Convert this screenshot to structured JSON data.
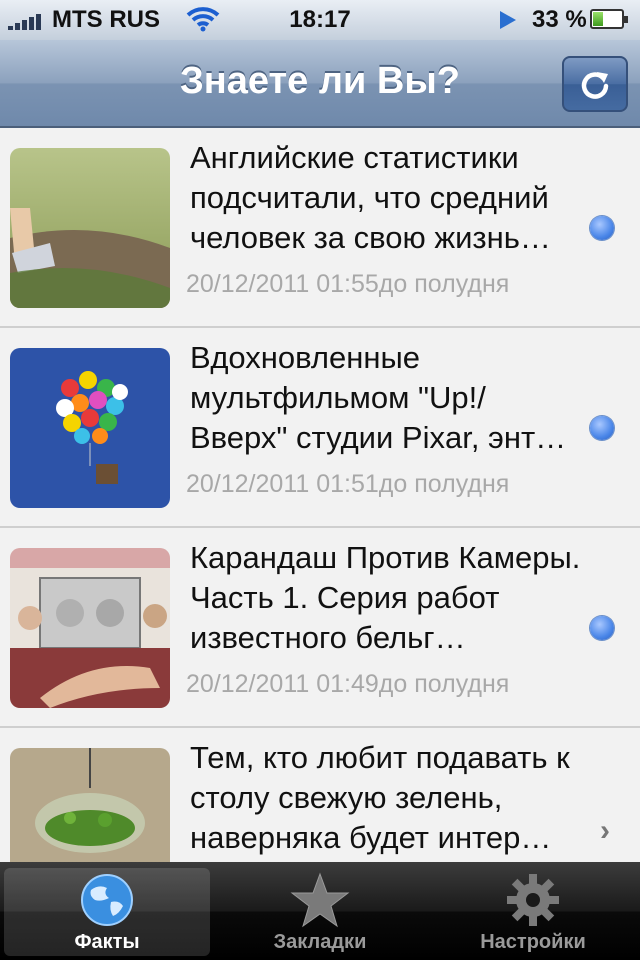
{
  "status_bar": {
    "carrier": "MTS RUS",
    "time": "18:17",
    "battery_percent": "33 %",
    "battery_level": 0.33
  },
  "nav_bar": {
    "title": "Знаете ли Вы?"
  },
  "items": [
    {
      "headline": "Английские статистики подсчитали, что средний человек за свою жизнь…",
      "date": "20/12/2011 01:55до полудня",
      "indicator": "unread-dot"
    },
    {
      "headline": "Вдохновленные мультфильмом \"Up!/ Вверх\" студии Pixar, энт…",
      "date": "20/12/2011 01:51до полудня",
      "indicator": "unread-dot"
    },
    {
      "headline": "Карандаш Против Камеры. Часть 1. Серия работ известного бельг…",
      "date": "20/12/2011 01:49до полудня",
      "indicator": "unread-dot"
    },
    {
      "headline": "Тем, кто любит подавать к столу свежую зелень, наверняка будет интер…",
      "date": "",
      "indicator": "chevron"
    }
  ],
  "tab_bar": {
    "tabs": [
      {
        "label": "Факты",
        "icon": "globe-icon",
        "active": true
      },
      {
        "label": "Закладки",
        "icon": "star-icon",
        "active": false
      },
      {
        "label": "Настройки",
        "icon": "gear-icon",
        "active": false
      }
    ]
  },
  "colors": {
    "nav_bar": "#7b93b2",
    "unread_dot": "#4a86e8",
    "date_text": "#a8a8a8"
  }
}
